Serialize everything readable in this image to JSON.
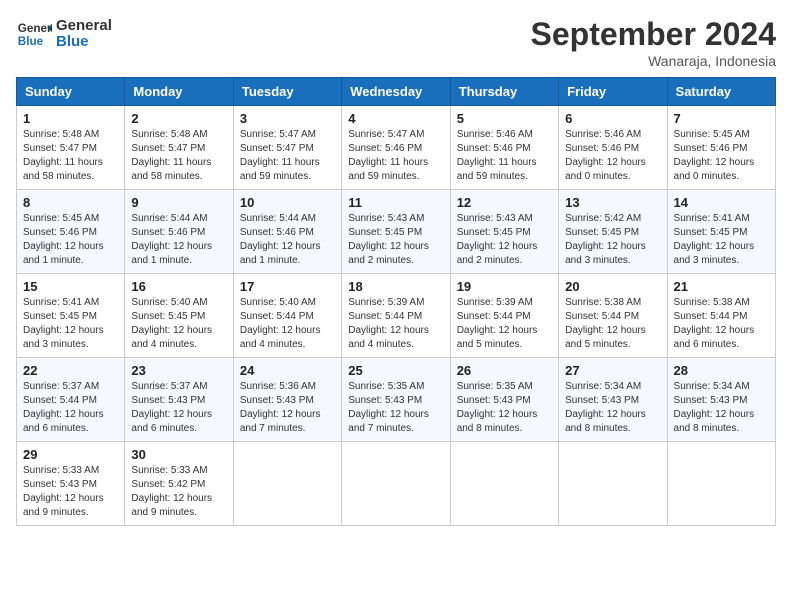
{
  "header": {
    "logo_line1": "General",
    "logo_line2": "Blue",
    "month": "September 2024",
    "location": "Wanaraja, Indonesia"
  },
  "weekdays": [
    "Sunday",
    "Monday",
    "Tuesday",
    "Wednesday",
    "Thursday",
    "Friday",
    "Saturday"
  ],
  "weeks": [
    [
      {
        "day": "1",
        "sunrise": "5:48 AM",
        "sunset": "5:47 PM",
        "daylight": "11 hours and 58 minutes."
      },
      {
        "day": "2",
        "sunrise": "5:48 AM",
        "sunset": "5:47 PM",
        "daylight": "11 hours and 58 minutes."
      },
      {
        "day": "3",
        "sunrise": "5:47 AM",
        "sunset": "5:47 PM",
        "daylight": "11 hours and 59 minutes."
      },
      {
        "day": "4",
        "sunrise": "5:47 AM",
        "sunset": "5:46 PM",
        "daylight": "11 hours and 59 minutes."
      },
      {
        "day": "5",
        "sunrise": "5:46 AM",
        "sunset": "5:46 PM",
        "daylight": "11 hours and 59 minutes."
      },
      {
        "day": "6",
        "sunrise": "5:46 AM",
        "sunset": "5:46 PM",
        "daylight": "12 hours and 0 minutes."
      },
      {
        "day": "7",
        "sunrise": "5:45 AM",
        "sunset": "5:46 PM",
        "daylight": "12 hours and 0 minutes."
      }
    ],
    [
      {
        "day": "8",
        "sunrise": "5:45 AM",
        "sunset": "5:46 PM",
        "daylight": "12 hours and 1 minute."
      },
      {
        "day": "9",
        "sunrise": "5:44 AM",
        "sunset": "5:46 PM",
        "daylight": "12 hours and 1 minute."
      },
      {
        "day": "10",
        "sunrise": "5:44 AM",
        "sunset": "5:46 PM",
        "daylight": "12 hours and 1 minute."
      },
      {
        "day": "11",
        "sunrise": "5:43 AM",
        "sunset": "5:45 PM",
        "daylight": "12 hours and 2 minutes."
      },
      {
        "day": "12",
        "sunrise": "5:43 AM",
        "sunset": "5:45 PM",
        "daylight": "12 hours and 2 minutes."
      },
      {
        "day": "13",
        "sunrise": "5:42 AM",
        "sunset": "5:45 PM",
        "daylight": "12 hours and 3 minutes."
      },
      {
        "day": "14",
        "sunrise": "5:41 AM",
        "sunset": "5:45 PM",
        "daylight": "12 hours and 3 minutes."
      }
    ],
    [
      {
        "day": "15",
        "sunrise": "5:41 AM",
        "sunset": "5:45 PM",
        "daylight": "12 hours and 3 minutes."
      },
      {
        "day": "16",
        "sunrise": "5:40 AM",
        "sunset": "5:45 PM",
        "daylight": "12 hours and 4 minutes."
      },
      {
        "day": "17",
        "sunrise": "5:40 AM",
        "sunset": "5:44 PM",
        "daylight": "12 hours and 4 minutes."
      },
      {
        "day": "18",
        "sunrise": "5:39 AM",
        "sunset": "5:44 PM",
        "daylight": "12 hours and 4 minutes."
      },
      {
        "day": "19",
        "sunrise": "5:39 AM",
        "sunset": "5:44 PM",
        "daylight": "12 hours and 5 minutes."
      },
      {
        "day": "20",
        "sunrise": "5:38 AM",
        "sunset": "5:44 PM",
        "daylight": "12 hours and 5 minutes."
      },
      {
        "day": "21",
        "sunrise": "5:38 AM",
        "sunset": "5:44 PM",
        "daylight": "12 hours and 6 minutes."
      }
    ],
    [
      {
        "day": "22",
        "sunrise": "5:37 AM",
        "sunset": "5:44 PM",
        "daylight": "12 hours and 6 minutes."
      },
      {
        "day": "23",
        "sunrise": "5:37 AM",
        "sunset": "5:43 PM",
        "daylight": "12 hours and 6 minutes."
      },
      {
        "day": "24",
        "sunrise": "5:36 AM",
        "sunset": "5:43 PM",
        "daylight": "12 hours and 7 minutes."
      },
      {
        "day": "25",
        "sunrise": "5:35 AM",
        "sunset": "5:43 PM",
        "daylight": "12 hours and 7 minutes."
      },
      {
        "day": "26",
        "sunrise": "5:35 AM",
        "sunset": "5:43 PM",
        "daylight": "12 hours and 8 minutes."
      },
      {
        "day": "27",
        "sunrise": "5:34 AM",
        "sunset": "5:43 PM",
        "daylight": "12 hours and 8 minutes."
      },
      {
        "day": "28",
        "sunrise": "5:34 AM",
        "sunset": "5:43 PM",
        "daylight": "12 hours and 8 minutes."
      }
    ],
    [
      {
        "day": "29",
        "sunrise": "5:33 AM",
        "sunset": "5:43 PM",
        "daylight": "12 hours and 9 minutes."
      },
      {
        "day": "30",
        "sunrise": "5:33 AM",
        "sunset": "5:42 PM",
        "daylight": "12 hours and 9 minutes."
      },
      null,
      null,
      null,
      null,
      null
    ]
  ]
}
